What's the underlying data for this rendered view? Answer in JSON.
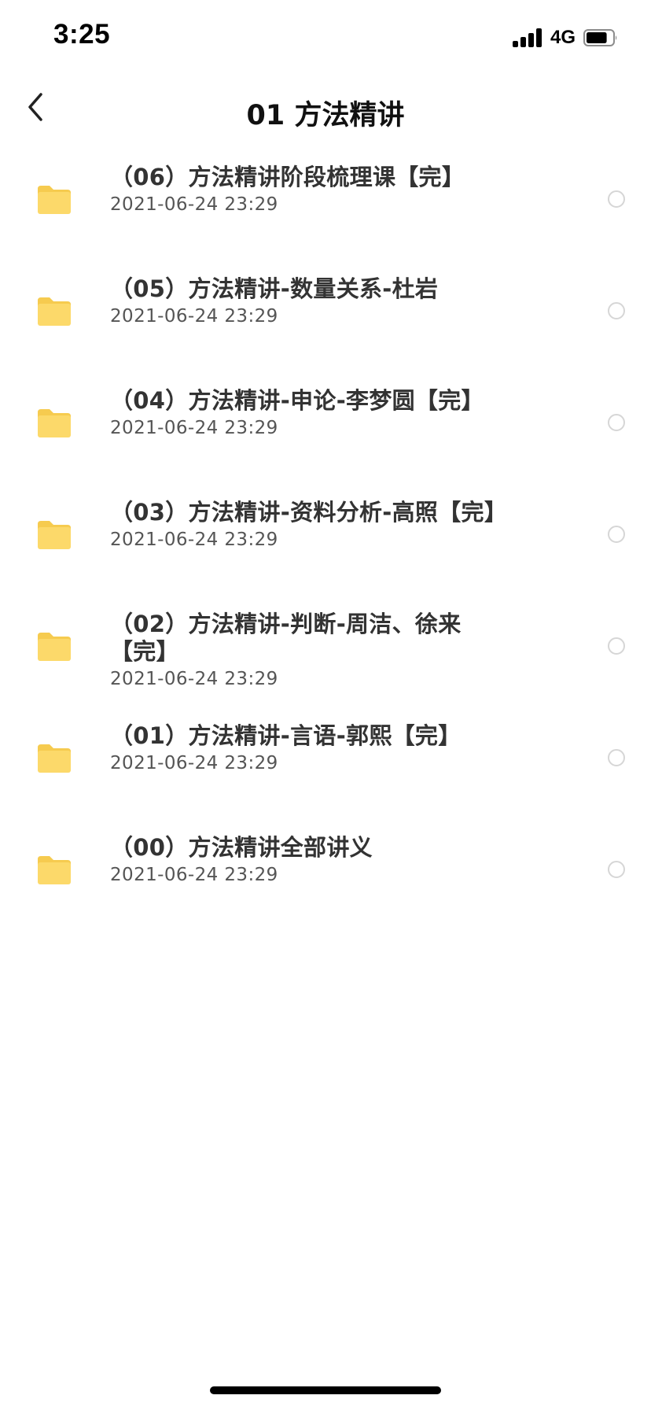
{
  "status_bar": {
    "time": "3:25",
    "network": "4G",
    "battery_level": 0.8
  },
  "nav": {
    "back_icon": "chevron-left-icon",
    "title": "01 方法精讲"
  },
  "colors": {
    "folder": "#FCD96A",
    "folder_tab": "#F6CB4F",
    "radio_border": "#D6D6D6"
  },
  "files": [
    {
      "name": "（06）方法精讲阶段梳理课【完】",
      "date": "2021-06-24 23:29",
      "icon": "folder-icon"
    },
    {
      "name": "（05）方法精讲-数量关系-杜岩",
      "date": "2021-06-24 23:29",
      "icon": "folder-icon"
    },
    {
      "name": "（04）方法精讲-申论-李梦圆【完】",
      "date": "2021-06-24 23:29",
      "icon": "folder-icon"
    },
    {
      "name": "（03）方法精讲-资料分析-高照【完】",
      "date": "2021-06-24 23:29",
      "icon": "folder-icon"
    },
    {
      "name": "（02）方法精讲-判断-周洁、徐来【完】",
      "date": "2021-06-24 23:29",
      "icon": "folder-icon"
    },
    {
      "name": "（01）方法精讲-言语-郭熙【完】",
      "date": "2021-06-24 23:29",
      "icon": "folder-icon"
    },
    {
      "name": "（00）方法精讲全部讲义",
      "date": "2021-06-24 23:29",
      "icon": "folder-icon"
    }
  ]
}
